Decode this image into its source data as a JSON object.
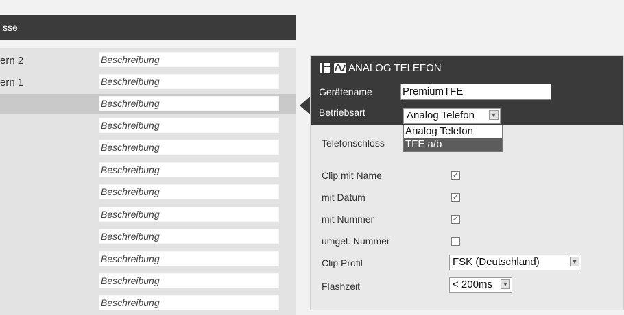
{
  "header": {
    "title": "sse"
  },
  "list": {
    "rows": [
      {
        "name": "ern 2",
        "description": "Beschreibung"
      },
      {
        "name": "ern 1",
        "description": "Beschreibung"
      },
      {
        "name": "",
        "description": "Beschreibung"
      },
      {
        "name": "",
        "description": "Beschreibung"
      },
      {
        "name": "",
        "description": "Beschreibung"
      },
      {
        "name": "",
        "description": "Beschreibung"
      },
      {
        "name": "",
        "description": "Beschreibung"
      },
      {
        "name": "",
        "description": "Beschreibung"
      },
      {
        "name": "",
        "description": "Beschreibung"
      },
      {
        "name": "",
        "description": "Beschreibung"
      },
      {
        "name": "",
        "description": "Beschreibung"
      },
      {
        "name": "",
        "description": "Beschreibung"
      }
    ]
  },
  "panel": {
    "title": "ANALOG TELEFON",
    "geraetename": {
      "label": "Gerätename",
      "value": "PremiumTFE"
    },
    "betriebsart": {
      "label": "Betriebsart",
      "value": "Analog Telefon",
      "options": [
        "Analog Telefon",
        "TFE a/b"
      ]
    },
    "telefonschloss": {
      "label": "Telefonschloss"
    },
    "clip_mit_name": {
      "label": "Clip mit Name",
      "checked": true
    },
    "mit_datum": {
      "label": "mit Datum",
      "checked": true
    },
    "mit_nummer": {
      "label": "mit Nummer",
      "checked": true
    },
    "umgel_nummer": {
      "label": "umgel. Nummer",
      "checked": false
    },
    "clip_profil": {
      "label": "Clip Profil",
      "value": "FSK (Deutschland)"
    },
    "flashzeit": {
      "label": "Flashzeit",
      "value": "< 200ms"
    }
  }
}
